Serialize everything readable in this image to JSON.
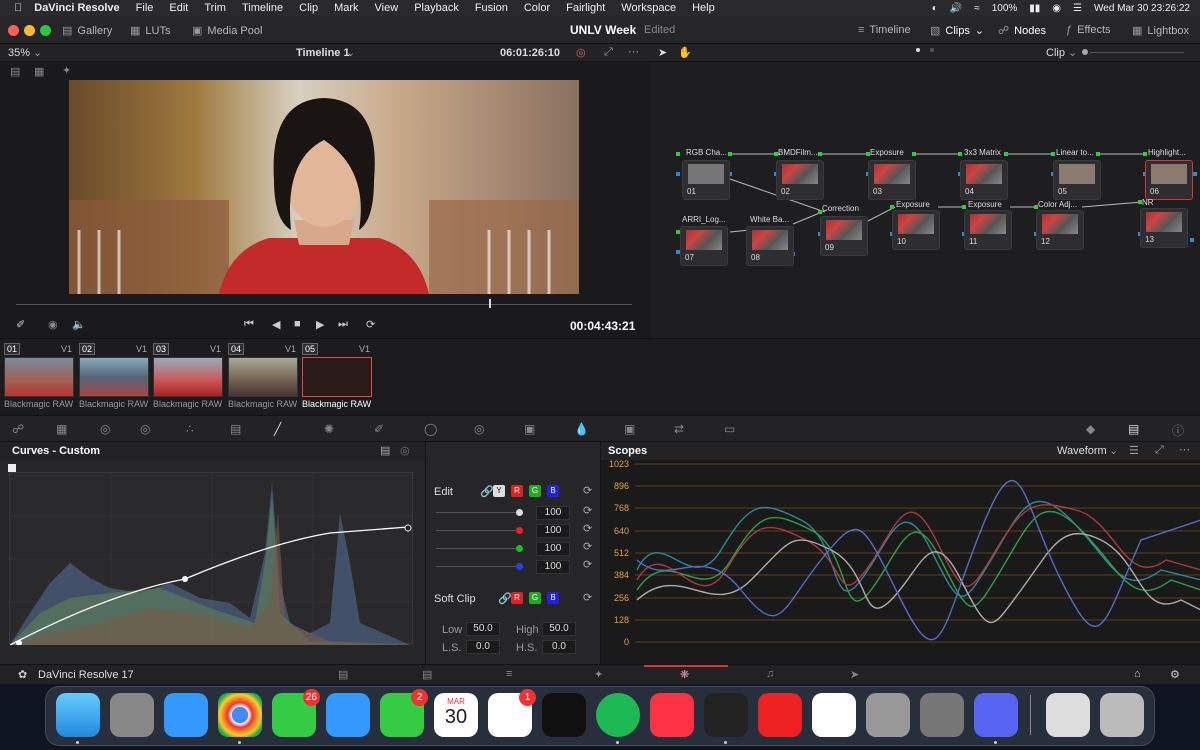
{
  "menubar": {
    "app": "DaVinci Resolve",
    "items": [
      "File",
      "Edit",
      "Trim",
      "Timeline",
      "Clip",
      "Mark",
      "View",
      "Playback",
      "Fusion",
      "Color",
      "Fairlight",
      "Workspace",
      "Help"
    ],
    "battery": "100%",
    "datetime": "Wed Mar 30  23:26:22"
  },
  "titlebar": {
    "gallery": "Gallery",
    "luts": "LUTs",
    "media_pool": "Media Pool",
    "project": "UNLV Week",
    "status": "Edited",
    "timeline": "Timeline",
    "clips": "Clips",
    "nodes": "Nodes",
    "effects": "Effects",
    "lightbox": "Lightbox"
  },
  "viewer": {
    "zoom": "35%",
    "timeline_name": "Timeline 1",
    "timecode": "06:01:26:10",
    "playhead": "00:04:43:21"
  },
  "nodegraph": {
    "mode": "Clip",
    "nodes": [
      {
        "label": "RGB Cha...",
        "num": "01"
      },
      {
        "label": "BMDFilm...",
        "num": "02"
      },
      {
        "label": "Exposure",
        "num": "03"
      },
      {
        "label": "3x3 Matrix",
        "num": "04"
      },
      {
        "label": "Linear to...",
        "num": "05"
      },
      {
        "label": "Highlight...",
        "num": "06"
      },
      {
        "label": "ARRI_Log...",
        "num": "07"
      },
      {
        "label": "White Ba...",
        "num": "08"
      },
      {
        "label": "Correction",
        "num": "09"
      },
      {
        "label": "Exposure",
        "num": "10"
      },
      {
        "label": "Exposure",
        "num": "11"
      },
      {
        "label": "Color Adj...",
        "num": "12"
      },
      {
        "label": "NR",
        "num": "13"
      }
    ]
  },
  "clips": [
    {
      "num": "01",
      "track": "V1",
      "name": "Blackmagic RAW"
    },
    {
      "num": "02",
      "track": "V1",
      "name": "Blackmagic RAW"
    },
    {
      "num": "03",
      "track": "V1",
      "name": "Blackmagic RAW"
    },
    {
      "num": "04",
      "track": "V1",
      "name": "Blackmagic RAW"
    },
    {
      "num": "05",
      "track": "V1",
      "name": "Blackmagic RAW"
    }
  ],
  "curves": {
    "title": "Curves - Custom",
    "edit_label": "Edit",
    "channels": [
      "Y",
      "R",
      "G",
      "B"
    ],
    "values": [
      "100",
      "100",
      "100",
      "100"
    ],
    "softclip": "Soft Clip",
    "low_label": "Low",
    "low": "50.0",
    "high_label": "High",
    "high": "50.0",
    "ls_label": "L.S.",
    "ls": "0.0",
    "hs_label": "H.S.",
    "hs": "0.0"
  },
  "scopes": {
    "title": "Scopes",
    "type": "Waveform",
    "ticks": [
      "1023",
      "896",
      "768",
      "640",
      "512",
      "384",
      "256",
      "128",
      "0"
    ]
  },
  "pagebar": {
    "product": "DaVinci Resolve 17"
  },
  "dock": {
    "messages_badge": "26",
    "facetime_badge": "2",
    "calendar_month": "MAR",
    "calendar_day": "30",
    "reminders_badge": "1"
  }
}
